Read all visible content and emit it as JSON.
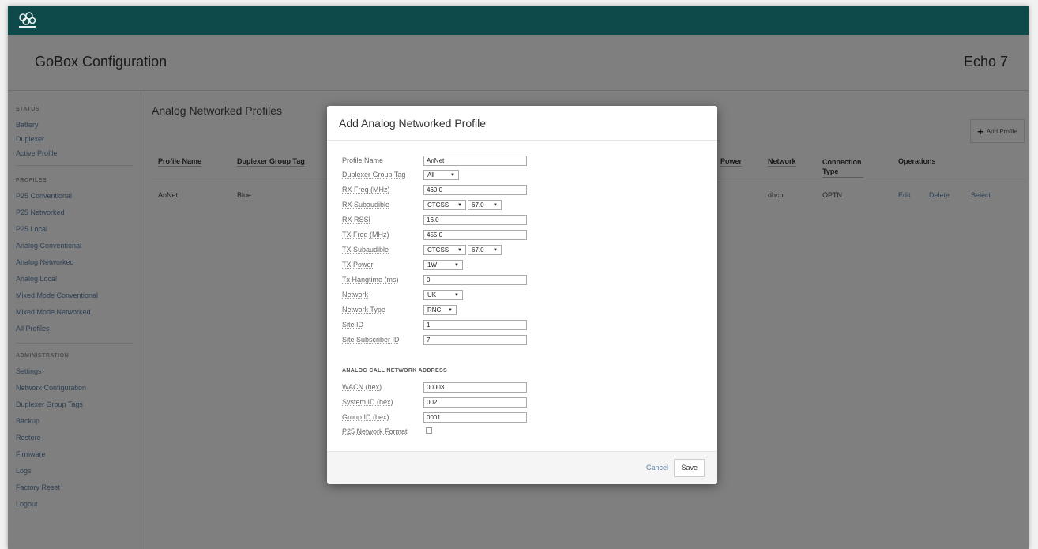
{
  "header": {
    "app_title": "GoBox Configuration",
    "device_name": "Echo 7",
    "logo_icon": "cloud-nodes-icon"
  },
  "sidebar": {
    "status_heading": "STATUS",
    "status_items": [
      "Battery",
      "Duplexer",
      "Active Profile"
    ],
    "profiles_heading": "PROFILES",
    "profile_items": [
      "P25 Conventional",
      "P25 Networked",
      "P25 Local",
      "Analog Conventional",
      "Analog Networked",
      "Analog Local",
      "Mixed Mode Conventional",
      "Mixed Mode Networked",
      "All Profiles"
    ],
    "admin_heading": "ADMINISTRATION",
    "admin_items": [
      "Settings",
      "Network Configuration",
      "Duplexer Group Tags",
      "Backup",
      "Restore",
      "Firmware",
      "Logs",
      "Factory Reset",
      "Logout"
    ]
  },
  "main": {
    "title": "Analog Networked Profiles",
    "add_profile_label": "Add Profile",
    "columns": {
      "profile_name": "Profile Name",
      "duplexer_group_tag": "Duplexer Group Tag",
      "power": "Power",
      "network": "Network",
      "connection_type": "Connection Type",
      "operations": "Operations"
    },
    "row": {
      "profile_name": "AnNet",
      "duplexer_group_tag": "Blue",
      "network": "dhcp",
      "connection_type": "OPTN",
      "edit": "Edit",
      "delete": "Delete",
      "select": "Select"
    }
  },
  "modal": {
    "title": "Add Analog Networked Profile",
    "profile_name": {
      "label": "Profile Name",
      "value": "AnNet"
    },
    "duplexer_group_tag": {
      "label": "Duplexer Group Tag",
      "value": "All"
    },
    "rx_freq": {
      "label": "RX Freq (MHz)",
      "value": "460.0"
    },
    "rx_subaudible": {
      "label": "RX Subaudible",
      "type": "CTCSS",
      "tone": "67.0"
    },
    "rx_rssi": {
      "label": "RX RSSI",
      "value": "16.0"
    },
    "tx_freq": {
      "label": "TX Freq (MHz)",
      "value": "455.0"
    },
    "tx_subaudible": {
      "label": "TX Subaudible",
      "type": "CTCSS",
      "tone": "67.0"
    },
    "tx_power": {
      "label": "TX Power",
      "value": "1W"
    },
    "tx_hangtime": {
      "label": "Tx Hangtime (ms)",
      "value": "0"
    },
    "network": {
      "label": "Network",
      "value": "UK"
    },
    "network_type": {
      "label": "Network Type",
      "value": "RNC"
    },
    "site_id": {
      "label": "Site ID",
      "value": "1"
    },
    "site_subscriber_id": {
      "label": "Site Subscriber ID",
      "value": "7"
    },
    "address_section": "ANALOG CALL NETWORK ADDRESS",
    "wacn": {
      "label": "WACN (hex)",
      "value": "00003"
    },
    "system_id": {
      "label": "System ID (hex)",
      "value": "002"
    },
    "group_id": {
      "label": "Group ID (hex)",
      "value": "0001"
    },
    "p25_network_format": {
      "label": "P25 Network Format"
    },
    "cancel_label": "Cancel",
    "save_label": "Save"
  }
}
